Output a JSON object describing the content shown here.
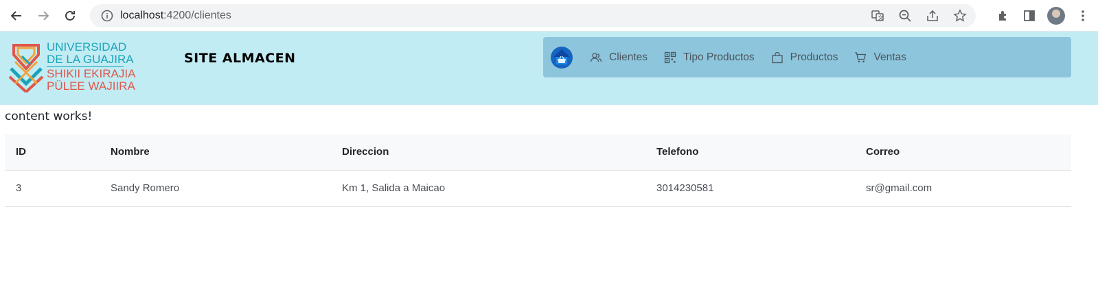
{
  "browser": {
    "url_host": "localhost",
    "url_path": ":4200/clientes"
  },
  "header": {
    "logo_lines": [
      "UNIVERSIDAD",
      "DE LA GUAJIRA",
      "SHIKII EKIRAJIA",
      "PÜLEE WAJIIRA"
    ],
    "site_title": "SITE ALMACEN"
  },
  "nav": {
    "items": [
      {
        "label": "Clientes",
        "icon": "users-icon"
      },
      {
        "label": "Tipo Productos",
        "icon": "qr-grid-icon"
      },
      {
        "label": "Productos",
        "icon": "bag-icon"
      },
      {
        "label": "Ventas",
        "icon": "cart-icon"
      }
    ]
  },
  "content": {
    "message": "content works!"
  },
  "table": {
    "headers": [
      "ID",
      "Nombre",
      "Direccion",
      "Telefono",
      "Correo"
    ],
    "rows": [
      [
        "3",
        "Sandy Romero",
        "Km 1, Salida a Maicao",
        "3014230581",
        "sr@gmail.com"
      ]
    ]
  },
  "colors": {
    "header_bg": "#c2ecf4",
    "nav_bg": "#8dc6dc",
    "logo_teal": "#1aa3b8",
    "logo_red": "#e0564a"
  }
}
